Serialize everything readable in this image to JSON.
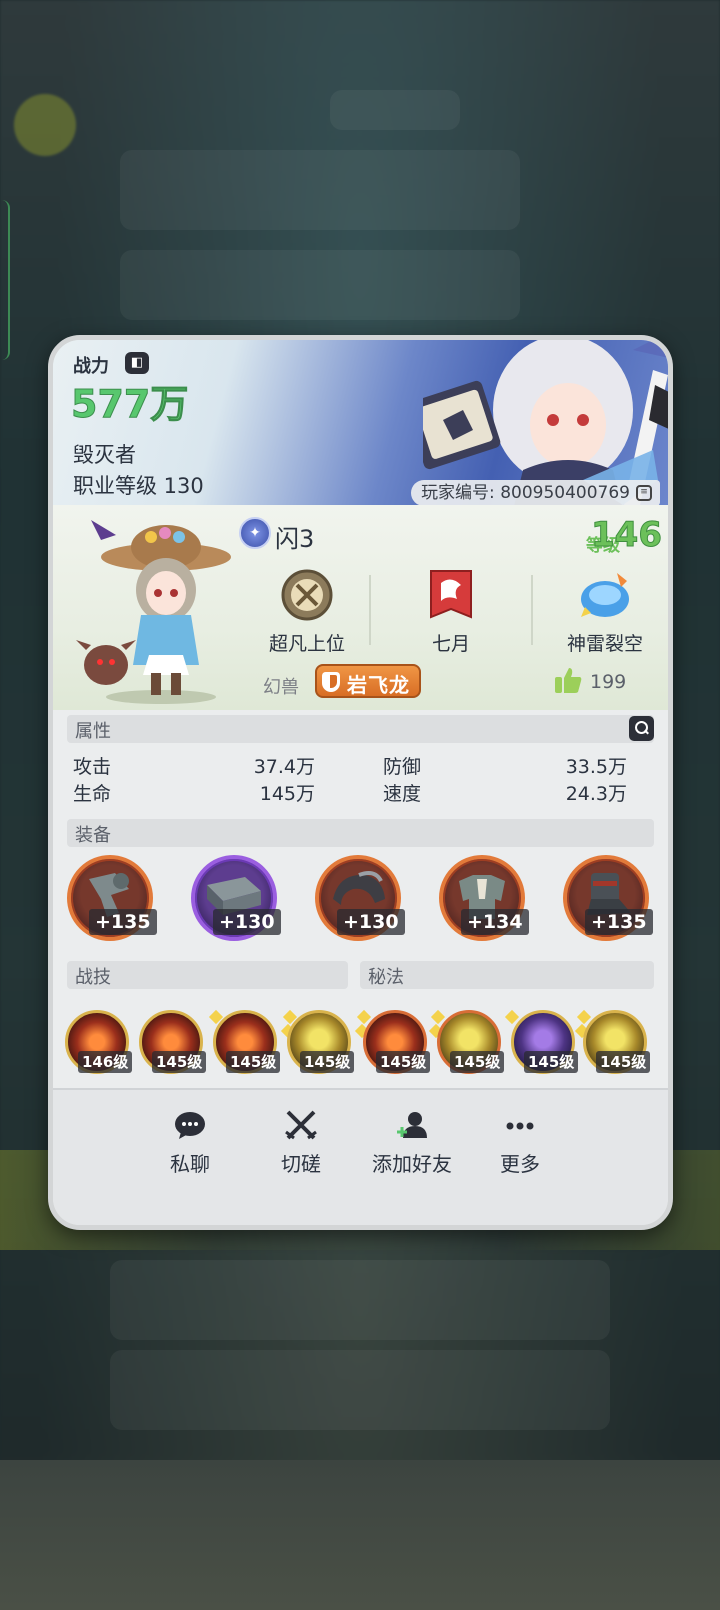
{
  "header": {
    "power_label": "战力",
    "power_value": "577万",
    "job_name": "毁灭者",
    "job_level": "职业等级 130",
    "player_id": "玩家编号: 800950400769"
  },
  "profile": {
    "name": "闪3",
    "level_label": "等级",
    "level_value": "146",
    "badges": [
      {
        "label": "超凡上位",
        "icon": "rank-crest-icon"
      },
      {
        "label": "七月",
        "icon": "guild-banner-icon"
      },
      {
        "label": "神雷裂空",
        "icon": "title-emblem-icon"
      }
    ],
    "pet_label": "幻兽",
    "pet_name": "岩飞龙",
    "likes": "199"
  },
  "attributes": {
    "title": "属性",
    "stats": [
      {
        "label": "攻击",
        "value": "37.4万"
      },
      {
        "label": "防御",
        "value": "33.5万"
      },
      {
        "label": "生命",
        "value": "145万"
      },
      {
        "label": "速度",
        "value": "24.3万"
      }
    ]
  },
  "equipment": {
    "title": "装备",
    "items": [
      {
        "plus": "+135",
        "quality": "orange",
        "icon": "weapon-icon"
      },
      {
        "plus": "+130",
        "quality": "purple",
        "icon": "book-icon"
      },
      {
        "plus": "+130",
        "quality": "orange",
        "icon": "helmet-icon"
      },
      {
        "plus": "+134",
        "quality": "orange",
        "icon": "armor-icon"
      },
      {
        "plus": "+135",
        "quality": "orange",
        "icon": "boots-icon"
      }
    ]
  },
  "skills": {
    "battle_title": "战技",
    "secret_title": "秘法",
    "items": [
      {
        "level": "146级",
        "style": "ember",
        "ring": "gold"
      },
      {
        "level": "145级",
        "style": "ember",
        "ring": "gold"
      },
      {
        "level": "145级",
        "style": "ember",
        "ring": "gold"
      },
      {
        "level": "145级",
        "style": "gold",
        "ring": "gold"
      },
      {
        "level": "145级",
        "style": "ember",
        "ring": "red"
      },
      {
        "level": "145级",
        "style": "gold",
        "ring": "red"
      },
      {
        "level": "145级",
        "style": "dark",
        "ring": "gold"
      },
      {
        "level": "145级",
        "style": "gold",
        "ring": "gold"
      }
    ]
  },
  "actions": [
    {
      "label": "私聊",
      "icon": "chat-icon"
    },
    {
      "label": "切磋",
      "icon": "crossed-swords-icon"
    },
    {
      "label": "添加好友",
      "icon": "add-friend-icon"
    },
    {
      "label": "更多",
      "icon": "more-icon"
    }
  ],
  "colors": {
    "accent_green": "#58c76e",
    "pet_orange": "#e07a2c",
    "equip_orange": "#e27a3a",
    "equip_purple": "#9a5ee0"
  }
}
